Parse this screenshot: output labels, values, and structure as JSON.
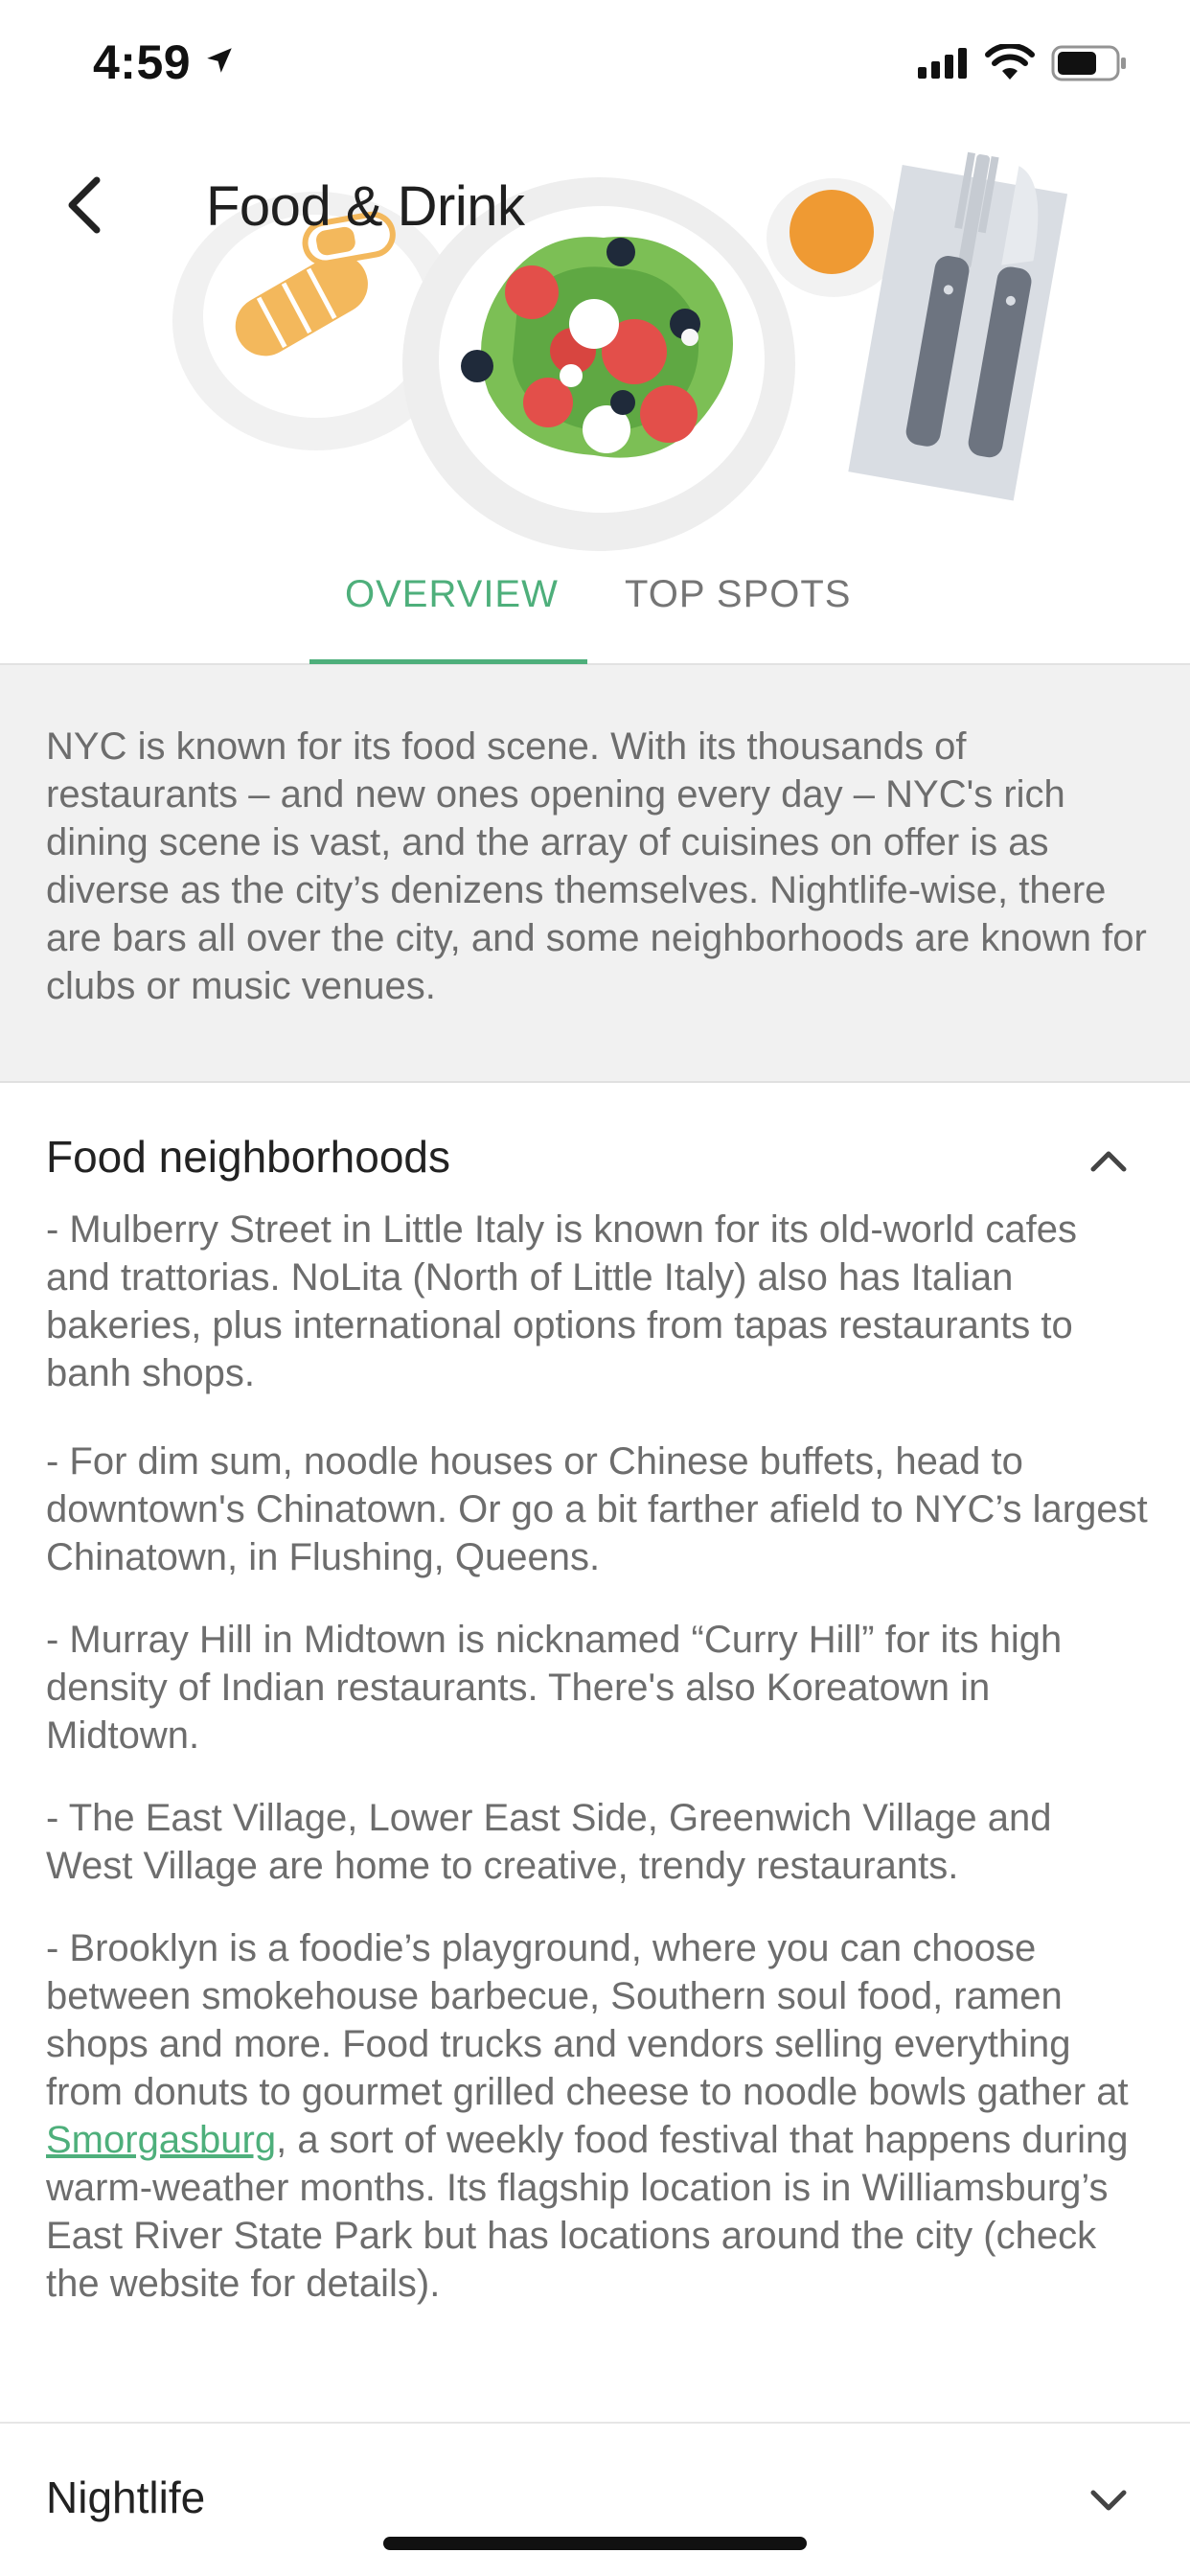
{
  "status_bar": {
    "time": "4:59",
    "icons": [
      "location-arrow-icon",
      "cellular-signal-icon",
      "wifi-icon",
      "battery-icon"
    ]
  },
  "header": {
    "title": "Food & Drink",
    "back_icon": "chevron-left-icon",
    "illustration": "food-plates-illustration"
  },
  "tabs": [
    {
      "label": "OVERVIEW",
      "active": true
    },
    {
      "label": "TOP SPOTS",
      "active": false
    }
  ],
  "summary": {
    "text": "NYC is known for its food scene. With its thousands of restaurants – and new ones opening every day – NYC's rich dining scene is vast, and the array of cuisines on offer is as diverse as the city’s denizens themselves. Nightlife-wise, there are bars all over the city, and some neighborhoods are known for clubs or music venues."
  },
  "sections": {
    "food": {
      "title": "Food neighborhoods",
      "expanded": true,
      "paragraphs": [
        "- Mulberry Street in Little Italy is known for its old-world cafes and trattorias. NoLita (North of Little Italy) also has Italian bakeries, plus international options from tapas restaurants to banh shops.",
        "- For dim sum, noodle houses or Chinese buffets, head to downtown's Chinatown. Or go a bit farther afield to NYC’s largest Chinatown, in Flushing, Queens.",
        "- Murray Hill in Midtown is nicknamed “Curry Hill” for its high density of Indian restaurants. There's also Koreatown in Midtown.",
        "- The East Village, Lower East Side, Greenwich Village and West Village are home to creative, trendy restaurants."
      ],
      "last_paragraph": {
        "before": "- Brooklyn is a foodie’s playground, where you can choose between smokehouse barbecue, Southern soul food, ramen shops and more. Food trucks and vendors selling everything from donuts to gourmet grilled cheese to noodle bowls gather at ",
        "link": "Smorgasburg",
        "after": ", a sort of weekly food festival that happens during warm-weather months. Its flagship location is in Williamsburg’s East River State Park but has locations around the city (check the website for details)."
      }
    },
    "nightlife": {
      "title": "Nightlife",
      "expanded": false
    }
  },
  "colors": {
    "accent": "#4eaf7b",
    "body_text": "#6d6d6d",
    "summary_bg": "#f1f1f1"
  }
}
